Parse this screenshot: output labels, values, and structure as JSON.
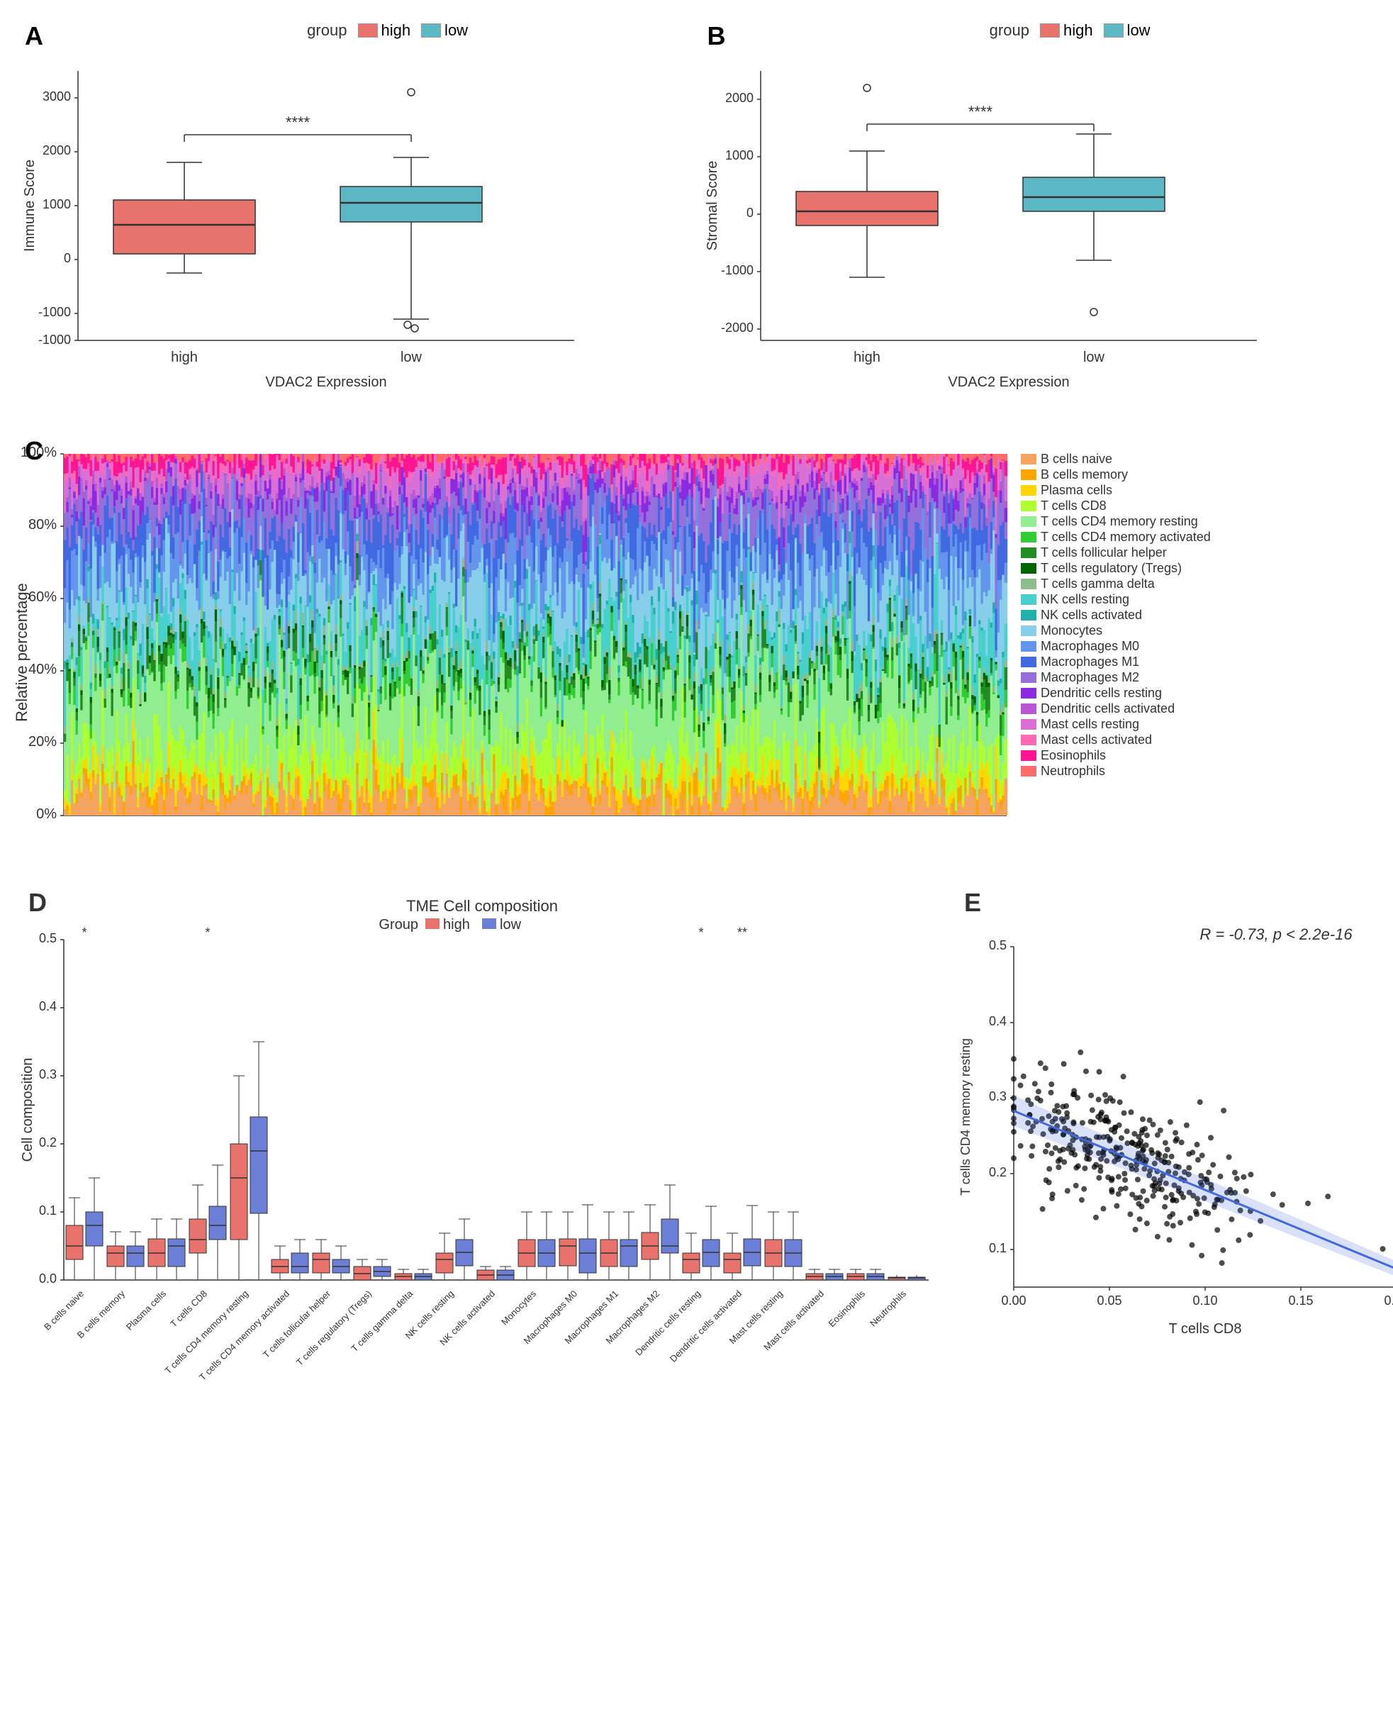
{
  "panelA": {
    "label": "A",
    "title": "Immune Score",
    "xLabel": "VDAC2 Expression",
    "yLabel": "Immune Score",
    "legend": {
      "groupLabel": "group",
      "high": "high",
      "low": "low",
      "highColor": "#E8736C",
      "lowColor": "#5BB8C4"
    },
    "significance": "****",
    "highBox": {
      "min": -250,
      "q1": 100,
      "median": 650,
      "q3": 1100,
      "max": 1800,
      "outliers": []
    },
    "lowBox": {
      "min": -1100,
      "q1": 700,
      "median": 1050,
      "q3": 1350,
      "max": 1900,
      "outliers": [
        3100,
        -1200,
        -1250
      ]
    }
  },
  "panelB": {
    "label": "B",
    "title": "Stromal Score",
    "xLabel": "VDAC2 Expression",
    "yLabel": "Stromal Score",
    "legend": {
      "groupLabel": "group",
      "high": "high",
      "low": "low",
      "highColor": "#E8736C",
      "lowColor": "#5BB8C4"
    },
    "significance": "****",
    "highBox": {
      "min": -1100,
      "q1": -200,
      "median": 50,
      "q3": 400,
      "max": 1100,
      "outliers": [
        2200
      ]
    },
    "lowBox": {
      "min": -800,
      "q1": 50,
      "median": 300,
      "q3": 650,
      "max": 1400,
      "outliers": [
        -1700
      ]
    }
  },
  "panelC": {
    "label": "C",
    "yLabel": "Relative percentage",
    "legend": [
      {
        "label": "B cells naive",
        "color": "#F4A460"
      },
      {
        "label": "B cells memory",
        "color": "#FFA500"
      },
      {
        "label": "Plasma cells",
        "color": "#FFD700"
      },
      {
        "label": "T cells CD8",
        "color": "#ADFF2F"
      },
      {
        "label": "T cells CD4 memory resting",
        "color": "#7FFF00"
      },
      {
        "label": "T cells CD4 memory activated",
        "color": "#32CD32"
      },
      {
        "label": "T cells follicular helper",
        "color": "#228B22"
      },
      {
        "label": "T cells regulatory (Tregs)",
        "color": "#006400"
      },
      {
        "label": "T cells gamma delta",
        "color": "#8FBC8F"
      },
      {
        "label": "NK cells resting",
        "color": "#48D1CC"
      },
      {
        "label": "NK cells activated",
        "color": "#20B2AA"
      },
      {
        "label": "Monocytes",
        "color": "#87CEEB"
      },
      {
        "label": "Macrophages M0",
        "color": "#6495ED"
      },
      {
        "label": "Macrophages M1",
        "color": "#4169E1"
      },
      {
        "label": "Macrophages M2",
        "color": "#9370DB"
      },
      {
        "label": "Dendritic cells resting",
        "color": "#8A2BE2"
      },
      {
        "label": "Dendritic cells activated",
        "color": "#BA55D3"
      },
      {
        "label": "Mast cells resting",
        "color": "#DA70D6"
      },
      {
        "label": "Mast cells activated",
        "color": "#FF69B4"
      },
      {
        "label": "Eosinophils",
        "color": "#FF1493"
      },
      {
        "label": "Neutrophils",
        "color": "#FF6B6B"
      }
    ]
  },
  "panelD": {
    "label": "D",
    "title": "TME Cell composition",
    "groupLabel": "Group",
    "high": "high",
    "low": "low",
    "highColor": "#E8736C",
    "lowColor": "#6B7FD7",
    "yLabel": "Cell composition",
    "significance": [
      "*",
      "",
      "",
      "*",
      "",
      "",
      "",
      "",
      "",
      "",
      "",
      "",
      "",
      "",
      "",
      "*",
      "**",
      "",
      "",
      "",
      ""
    ],
    "cellTypes": [
      "B cells naive",
      "B cells memory",
      "Plasma cells",
      "T cells CD8",
      "T cells CD4 memory resting",
      "T cells CD4 memory activated",
      "T cells follicular helper",
      "T cells regulatory (Tregs)",
      "T cells gamma delta",
      "NK cells resting",
      "NK cells activated",
      "Monocytes",
      "Macrophages M0",
      "Macrophages M1",
      "Macrophages M2",
      "Dendritic cells resting",
      "Dendritic cells activated",
      "Mast cells resting",
      "Mast cells activated",
      "Eosinophils",
      "Neutrophils"
    ]
  },
  "panelE": {
    "label": "E",
    "xLabel": "T cells CD8",
    "yLabel": "T cells CD4 memory resting",
    "correlation": "R = -0.73, p < 2.2e-16",
    "lineColor": "#4169E1",
    "pointColor": "#000000"
  }
}
